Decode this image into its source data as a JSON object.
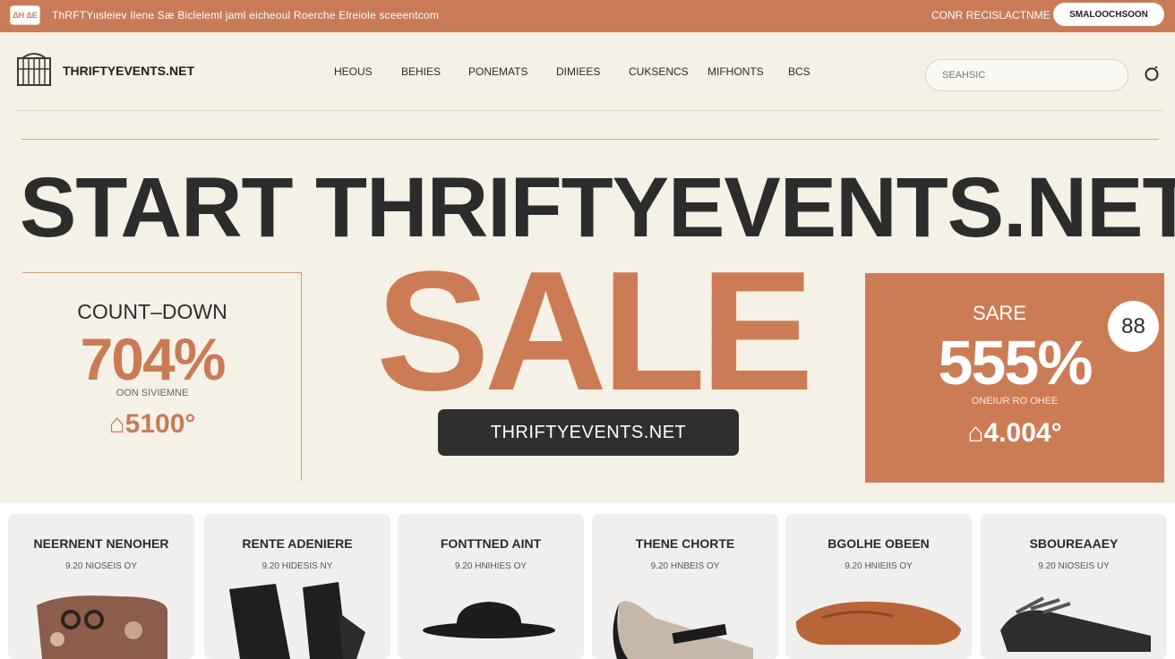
{
  "topbar": {
    "logo": "ΔΗ ΔΕ",
    "promo_text": "ThRFTΥιιsleiev Ilene Sæ Bicleleml jaml eicheoul Roerche Elreiole sceeentcom",
    "right_link": "CONR RECISLACTNME",
    "pill_label": "SMALOOCHSOON"
  },
  "brand": {
    "name": "THRIFTYEVENTS.NET"
  },
  "nav": {
    "items": [
      "HEOUS",
      "BEHIES",
      "PONEMATS",
      "DIMIEES",
      "CUKSENCS",
      "MIFHONTS",
      "BCS"
    ]
  },
  "search": {
    "placeholder": "SEAHSIC"
  },
  "hero": {
    "title": "START THRIFTYEVENTS.NET",
    "sale_word": "SALE",
    "cta_label": "THRIFTYEVENTS.NET"
  },
  "countdown": {
    "label": "COUNT–DOWN",
    "percent": "704%",
    "sub": "OON SIVIEMNE",
    "price": "⌂5100°"
  },
  "promo_box": {
    "label": "SARE",
    "percent": "555%",
    "sub": "ONEIUR RO OHEE",
    "price": "⌂4.004°",
    "badge": "88"
  },
  "products": [
    {
      "name": "NEERNENT NENOHER",
      "meta": "9.20 NIOSEIS OY"
    },
    {
      "name": "RENTE ADENIERE",
      "meta": "9.20 HIDESIS NY"
    },
    {
      "name": "FONTTNED AINT",
      "meta": "9.20 HNIHIES OY"
    },
    {
      "name": "THENE CHORTE",
      "meta": "9.20 HNBEIS OY"
    },
    {
      "name": "BGOLHE OBEEN",
      "meta": "9.20 HNIEIIS OY"
    },
    {
      "name": "SBOUREAAEY",
      "meta": "9.20 NIOSEIS UY"
    }
  ],
  "colors": {
    "accent": "#c97b57",
    "background": "#f6f1e6",
    "dark": "#2f2f2f"
  }
}
